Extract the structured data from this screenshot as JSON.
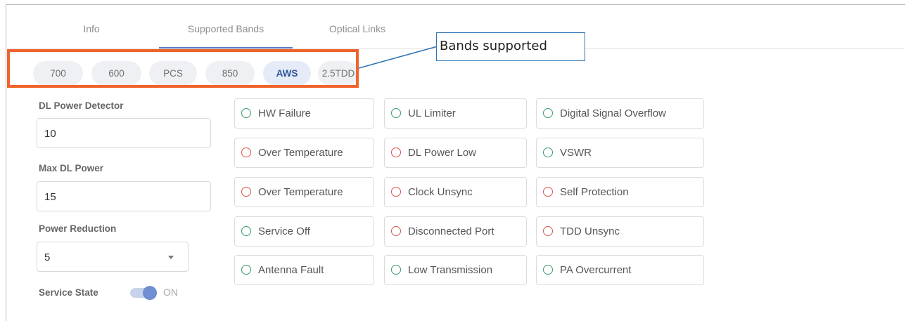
{
  "tabs": [
    {
      "label": "Info",
      "active": false
    },
    {
      "label": "Supported Bands",
      "active": true
    },
    {
      "label": "Optical Links",
      "active": false
    }
  ],
  "bands": [
    {
      "label": "700",
      "active": false
    },
    {
      "label": "600",
      "active": false
    },
    {
      "label": "PCS",
      "active": false
    },
    {
      "label": "850",
      "active": false
    },
    {
      "label": "AWS",
      "active": true
    },
    {
      "label": "2.5TDD",
      "active": false
    }
  ],
  "callout": {
    "text": "Bands supported"
  },
  "form": {
    "dl_power_detector": {
      "label": "DL Power Detector",
      "value": "10"
    },
    "max_dl_power": {
      "label": "Max DL Power",
      "value": "15"
    },
    "power_reduction": {
      "label": "Power Reduction",
      "value": "5"
    },
    "service_state": {
      "label": "Service State",
      "value": "ON",
      "enabled": true
    }
  },
  "alarms": [
    {
      "label": "HW Failure",
      "status": "green"
    },
    {
      "label": "UL Limiter",
      "status": "green"
    },
    {
      "label": "Digital Signal Overflow",
      "status": "green"
    },
    {
      "label": "Over Temperature",
      "status": "red"
    },
    {
      "label": "DL Power Low",
      "status": "red"
    },
    {
      "label": "VSWR",
      "status": "green"
    },
    {
      "label": "Over Temperature",
      "status": "red"
    },
    {
      "label": "Clock Unsync",
      "status": "red"
    },
    {
      "label": "Self Protection",
      "status": "red"
    },
    {
      "label": "Service Off",
      "status": "green"
    },
    {
      "label": "Disconnected Port",
      "status": "red"
    },
    {
      "label": "TDD Unsync",
      "status": "red"
    },
    {
      "label": "Antenna Fault",
      "status": "green"
    },
    {
      "label": "Low Transmission",
      "status": "green"
    },
    {
      "label": "PA Overcurrent",
      "status": "green"
    }
  ],
  "colors": {
    "highlight": "#f0642c",
    "callout_border": "#2e74b5",
    "status_green": "#3a9b6a",
    "status_red": "#d9534f",
    "accent": "#5b7fc6"
  }
}
